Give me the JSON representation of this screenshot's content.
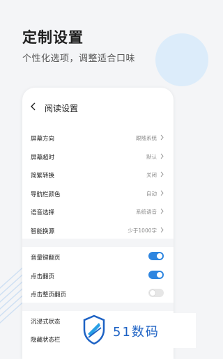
{
  "header": {
    "title": "定制设置",
    "subtitle": "个性化选项，调整适合口味"
  },
  "screen": {
    "nav_title": "阅读设置",
    "settings": [
      {
        "label": "屏幕方向",
        "value": "跟随系统"
      },
      {
        "label": "屏幕超时",
        "value": "默认"
      },
      {
        "label": "简繁转换",
        "value": "关闭"
      },
      {
        "label": "导航栏颜色",
        "value": "自动"
      },
      {
        "label": "语音选择",
        "value": "系统语音"
      },
      {
        "label": "智能换源",
        "value": "少于1000字"
      }
    ],
    "toggles": [
      {
        "label": "音量键翻页",
        "on": true
      },
      {
        "label": "点击翻页",
        "on": true
      },
      {
        "label": "点击整页翻页",
        "on": false
      },
      {
        "label": "沉浸式状态",
        "on": true
      },
      {
        "label": "隐藏状态栏",
        "on": false
      }
    ]
  },
  "watermark": {
    "text": "51数码",
    "color": "#1d62c4"
  },
  "colors": {
    "accent": "#2f86e0",
    "background": "#f4f5f7"
  }
}
